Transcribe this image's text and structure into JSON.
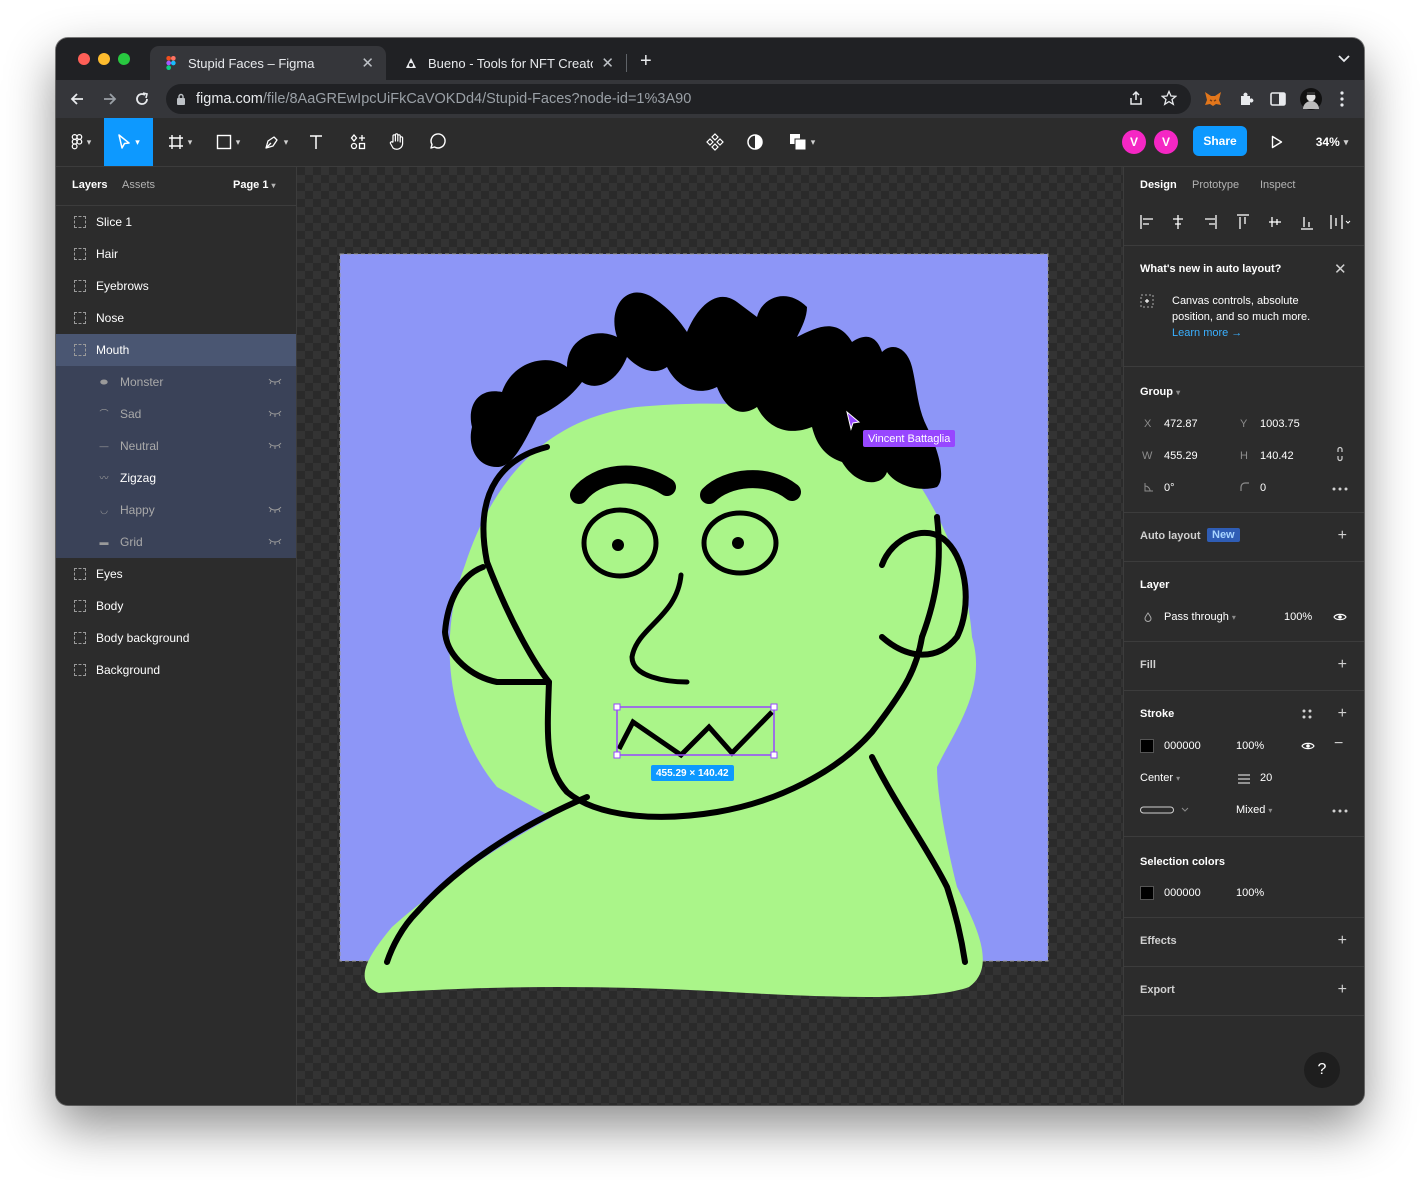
{
  "browser": {
    "tabs": [
      {
        "title": "Stupid Faces – Figma",
        "active": true,
        "icon": "figma-icon"
      },
      {
        "title": "Bueno - Tools for NFT Creators",
        "active": false,
        "icon": "bueno-icon"
      }
    ],
    "url_host": "figma.com",
    "url_path": "/file/8AaGREwIpcUiFkCaVOKDd4/Stupid-Faces?node-id=1%3A90"
  },
  "toolbar": {
    "avatars": [
      "V",
      "V"
    ],
    "share_label": "Share",
    "zoom": "34%"
  },
  "left_panel": {
    "tabs": [
      "Layers",
      "Assets"
    ],
    "page": "Page 1",
    "layers": [
      {
        "name": "Slice 1"
      },
      {
        "name": "Hair"
      },
      {
        "name": "Eyebrows"
      },
      {
        "name": "Nose"
      },
      {
        "name": "Mouth",
        "selected": true
      },
      {
        "name": "Monster",
        "child": true,
        "hidden": true
      },
      {
        "name": "Sad",
        "child": true,
        "hidden": true
      },
      {
        "name": "Neutral",
        "child": true,
        "hidden": true
      },
      {
        "name": "Zigzag",
        "child": true,
        "hidden": false
      },
      {
        "name": "Happy",
        "child": true,
        "hidden": true
      },
      {
        "name": "Grid",
        "child": true,
        "hidden": true
      },
      {
        "name": "Eyes"
      },
      {
        "name": "Body"
      },
      {
        "name": "Body background"
      },
      {
        "name": "Background"
      }
    ]
  },
  "canvas": {
    "selection_size": "455.29 × 140.42",
    "cursor_user": "Vincent Battaglia",
    "colors": {
      "background": "#8d96f7",
      "skin": "#aaf589",
      "line": "#000000"
    }
  },
  "right_panel": {
    "tabs": [
      "Design",
      "Prototype",
      "Inspect"
    ],
    "notice": {
      "title": "What's new in auto layout?",
      "body": "Canvas controls, absolute position, and so much more.",
      "link": "Learn more →"
    },
    "group": {
      "title": "Group",
      "x": "472.87",
      "y": "1003.75",
      "w": "455.29",
      "h": "140.42",
      "rotation": "0°",
      "radius": "0"
    },
    "auto_layout": {
      "title": "Auto layout",
      "badge": "New"
    },
    "layer": {
      "title": "Layer",
      "blend": "Pass through",
      "opacity": "100%"
    },
    "fill": {
      "title": "Fill"
    },
    "stroke": {
      "title": "Stroke",
      "color": "000000",
      "opacity": "100%",
      "align": "Center",
      "weight": "20",
      "join": "Mixed"
    },
    "selection_colors": {
      "title": "Selection colors",
      "color": "000000",
      "opacity": "100%"
    },
    "effects": {
      "title": "Effects"
    },
    "export": {
      "title": "Export"
    },
    "help": "?"
  }
}
